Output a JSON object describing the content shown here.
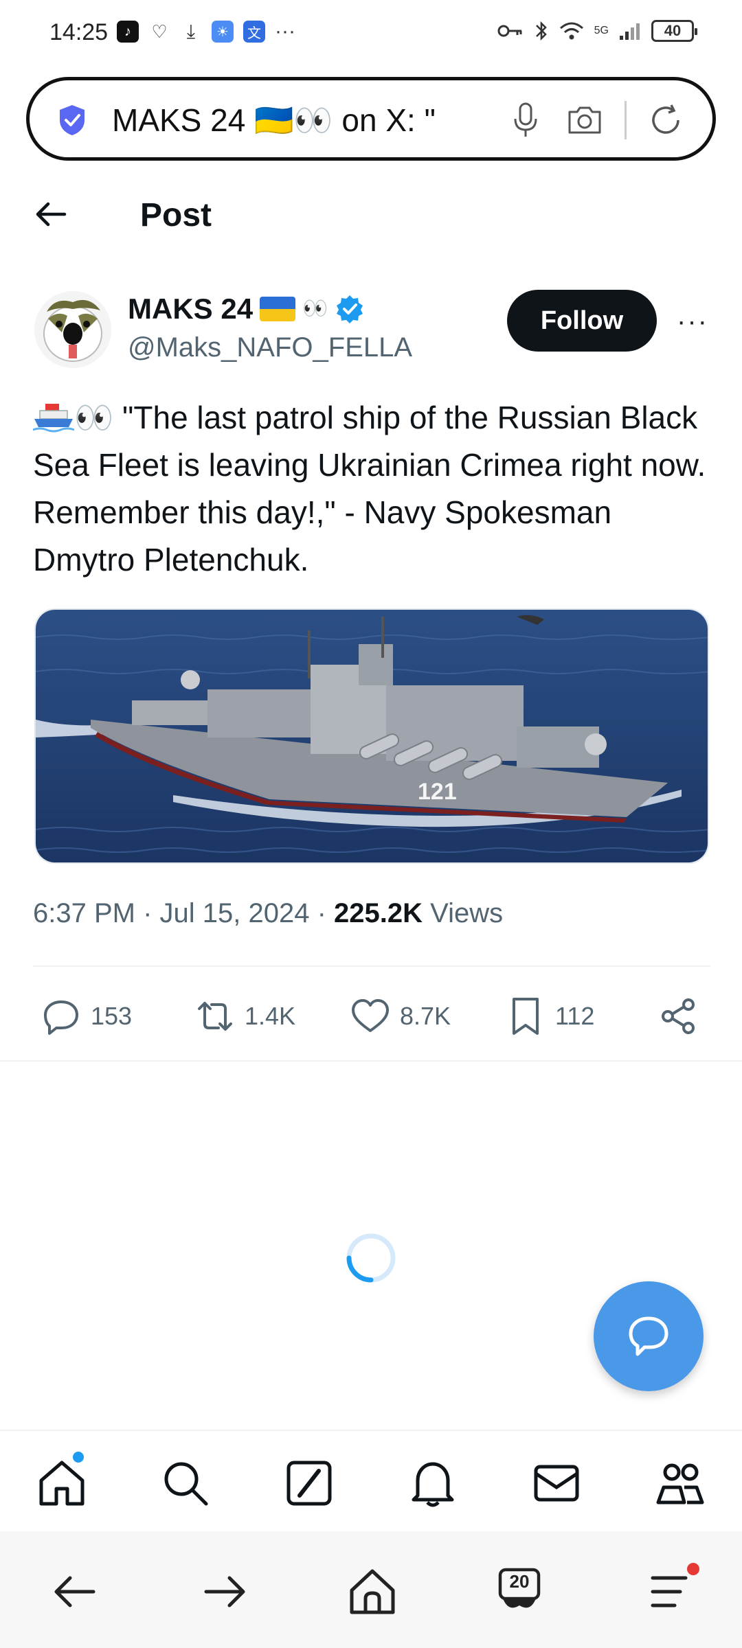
{
  "status_bar": {
    "time": "14:25",
    "more": "···",
    "network": "5G",
    "battery": "40"
  },
  "url_bar": {
    "text": "MAKS 24 🇺🇦👀 on X: \""
  },
  "header": {
    "title": "Post"
  },
  "author": {
    "name": "MAKS 24",
    "name_emoji": "👀",
    "handle": "@Maks_NAFO_FELLA",
    "follow_label": "Follow",
    "more_label": "···"
  },
  "tweet": {
    "emoji_suffix": "👀",
    "text": " \"The last patrol ship of the Russian Black Sea Fleet is leaving Ukrainian Crimea right now. Remember this day!,\" - Navy Spokesman Dmytro Pletenchuk.",
    "image_hull_number": "121",
    "time": "6:37 PM",
    "date": "Jul 15, 2024",
    "views_count": "225.2K",
    "views_label": "Views"
  },
  "actions": {
    "replies": "153",
    "reposts": "1.4K",
    "likes": "8.7K",
    "bookmarks": "112"
  },
  "browser": {
    "tab_count": "20"
  },
  "colors": {
    "accent": "#1d9bf0",
    "fab": "#4a99e9",
    "text": "#0f1419",
    "muted": "#536471"
  }
}
